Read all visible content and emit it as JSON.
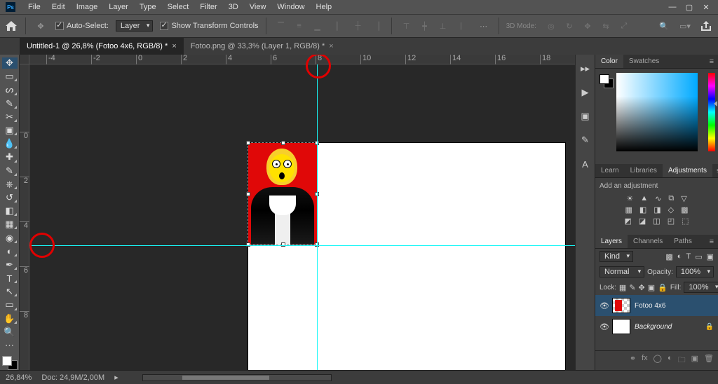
{
  "menus": [
    "File",
    "Edit",
    "Image",
    "Layer",
    "Type",
    "Select",
    "Filter",
    "3D",
    "View",
    "Window",
    "Help"
  ],
  "options": {
    "auto_select": "Auto-Select:",
    "layer": "Layer",
    "transform": "Show Transform Controls",
    "mode": "3D Mode:"
  },
  "tabs": [
    {
      "label": "Untitled-1 @ 26,8% (Fotoo 4x6, RGB/8) *",
      "active": true
    },
    {
      "label": "Fotoo.png @ 33,3% (Layer 1, RGB/8) *",
      "active": false
    }
  ],
  "rulers_h": [
    "-4",
    "-2",
    "0",
    "2",
    "4",
    "6",
    "8",
    "10",
    "12",
    "14",
    "16",
    "18"
  ],
  "rulers_v": [
    "0",
    "2",
    "4",
    "6",
    "8"
  ],
  "panels": {
    "color_tabs": [
      "Color",
      "Swatches"
    ],
    "learn_tabs": [
      "Learn",
      "Libraries",
      "Adjustments"
    ],
    "adj_text": "Add an adjustment",
    "layer_tabs": [
      "Layers",
      "Channels",
      "Paths"
    ],
    "kind": "Kind",
    "blend": "Normal",
    "opacity_lbl": "Opacity:",
    "opacity_val": "100%",
    "lock_lbl": "Lock:",
    "fill_lbl": "Fill:",
    "fill_val": "100%",
    "layers": [
      {
        "name": "Fotoo 4x6",
        "bg": false,
        "sel": true
      },
      {
        "name": "Background",
        "bg": true,
        "sel": false
      }
    ]
  },
  "status": {
    "zoom": "26,84%",
    "doc": "Doc: 24,9M/2,00M"
  }
}
